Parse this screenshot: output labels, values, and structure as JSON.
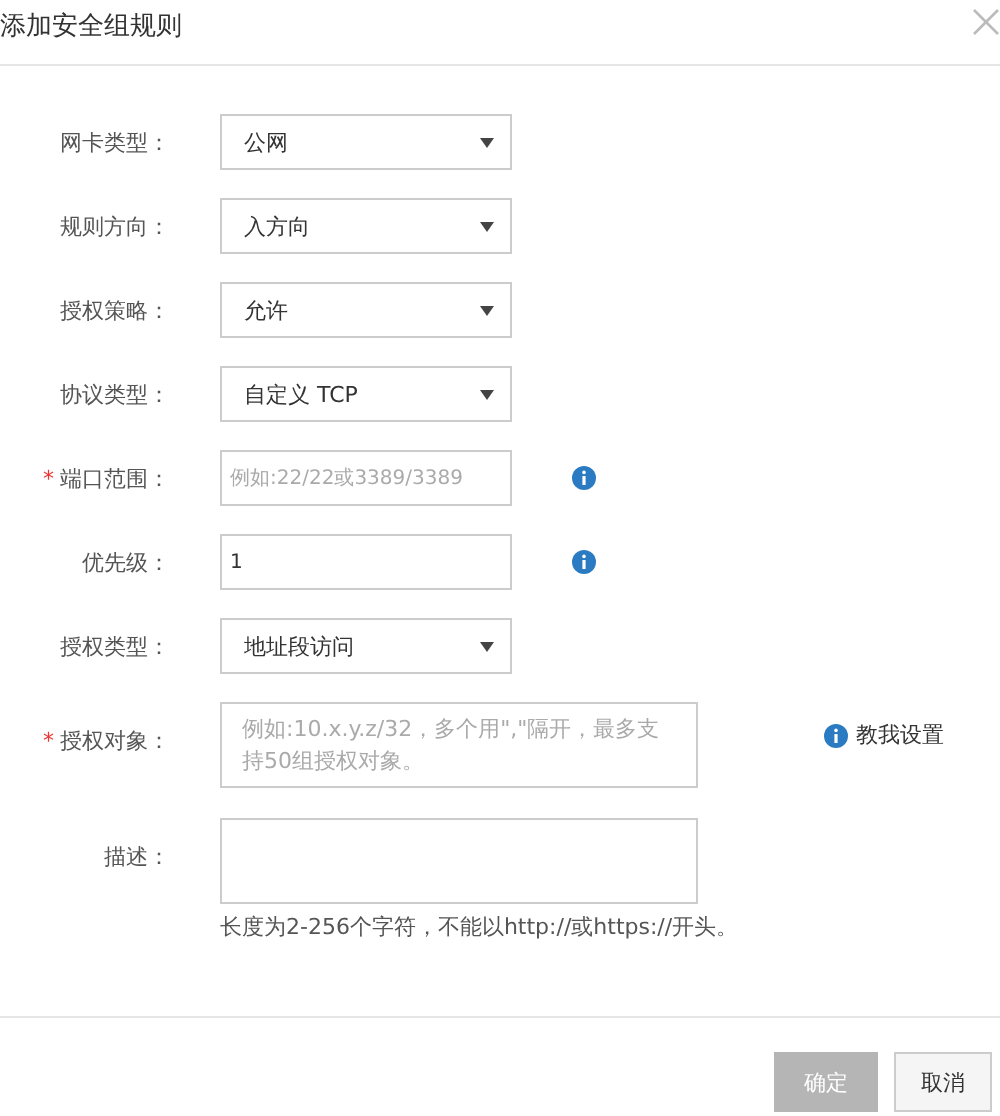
{
  "dialog": {
    "title": "添加安全组规则"
  },
  "fields": [
    {
      "label": "网卡类型：",
      "kind": "select",
      "value": "公网"
    },
    {
      "label": "规则方向：",
      "kind": "select",
      "value": "入方向"
    },
    {
      "label": "授权策略：",
      "kind": "select",
      "value": "允许"
    },
    {
      "label": "协议类型：",
      "kind": "select",
      "value": "自定义 TCP"
    },
    {
      "label": "端口范围：",
      "required_mark": "*",
      "kind": "input",
      "placeholder": "例如:22/22或3389/3389",
      "info": true
    },
    {
      "label": "优先级：",
      "kind": "input",
      "value": "1",
      "info": true
    },
    {
      "label": "授权类型：",
      "kind": "select",
      "value": "地址段访问"
    },
    {
      "label": "授权对象：",
      "required_mark": "*",
      "kind": "textarea",
      "placeholder": "例如:10.x.y.z/32，多个用\",\"隔开，最多支持50组授权对象。",
      "help_link": "教我设置"
    },
    {
      "label": "描述：",
      "kind": "textarea",
      "hint": "长度为2-256个字符，不能以http://或https://开头。"
    }
  ],
  "buttons": [
    {
      "label": "确定",
      "disabled": true
    },
    {
      "label": "取消",
      "disabled": false
    }
  ]
}
